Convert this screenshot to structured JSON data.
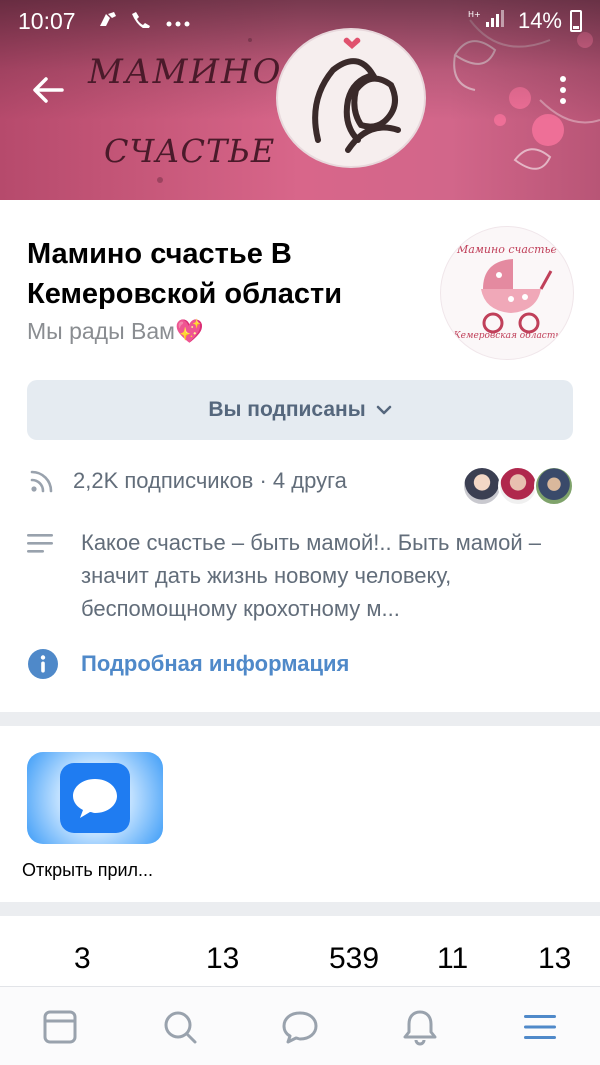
{
  "status_bar": {
    "time": "10:07",
    "battery": "14%",
    "icons": [
      "cleaner-icon",
      "call-icon",
      "more-dots-icon",
      "signal-icon",
      "battery-icon"
    ]
  },
  "cover": {
    "title_line_1": "МАМИНО",
    "title_line_2": "СЧАСТЬЕ"
  },
  "group": {
    "name": "Мамино счастье В Кемеровской области",
    "status": "Мы рады Вам💖",
    "avatar_text_top": "Мамино счастье",
    "avatar_text_bottom": "Кемеровская область"
  },
  "subscribe_button": {
    "label": "Вы подписаны"
  },
  "subscribers": {
    "text": "2,2K подписчиков · 4 друга"
  },
  "description": {
    "text": "Какое счастье – быть мамой!..  Быть мамой – значит дать жизнь новому человеку, беспомощному крохотному м..."
  },
  "more_info": {
    "label": "Подробная информация"
  },
  "apps": {
    "open_label": "Открыть прил..."
  },
  "counters": [
    "3",
    "13",
    "539",
    "11",
    "13"
  ],
  "bottom_nav": [
    "news-icon",
    "search-icon",
    "messages-icon",
    "notifications-icon",
    "menu-icon"
  ],
  "colors": {
    "accent": "#4f89c9",
    "button_bg": "#e5ebf1",
    "button_text": "#55677d",
    "secondary_text": "#626d7a"
  }
}
